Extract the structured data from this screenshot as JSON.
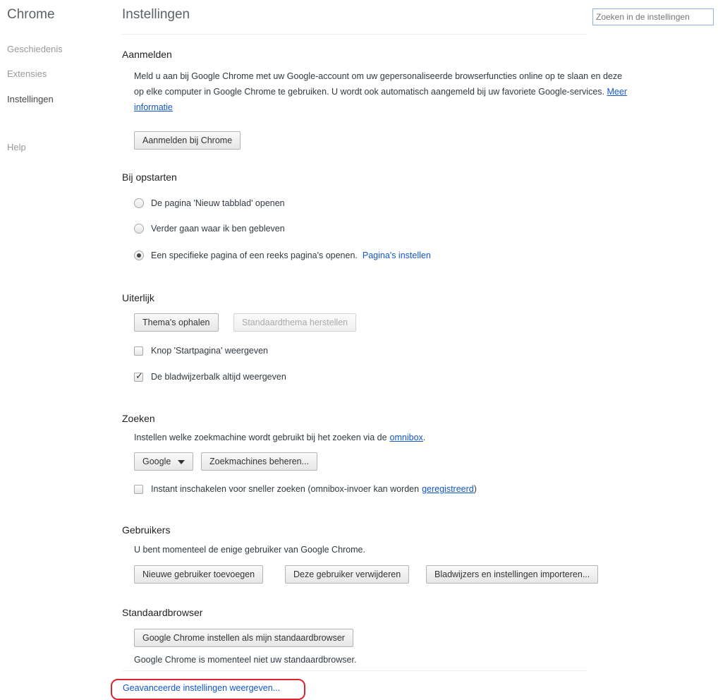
{
  "sidebar": {
    "brand": "Chrome",
    "items": [
      {
        "label": "Geschiedenis"
      },
      {
        "label": "Extensies"
      },
      {
        "label": "Instellingen"
      },
      {
        "label": "Help"
      }
    ]
  },
  "header": {
    "title": "Instellingen",
    "search_placeholder": "Zoeken in de instellingen"
  },
  "signin": {
    "heading": "Aanmelden",
    "text": "Meld u aan bij Google Chrome met uw Google-account om uw gepersonaliseerde browserfuncties online op te slaan en deze op elke computer in Google Chrome te gebruiken. U wordt ook automatisch aangemeld bij uw favoriete Google-services.",
    "more_link": "Meer informatie",
    "button": "Aanmelden bij Chrome"
  },
  "startup": {
    "heading": "Bij opstarten",
    "options": [
      {
        "label": "De pagina 'Nieuw tabblad' openen",
        "selected": false
      },
      {
        "label": "Verder gaan waar ik ben gebleven",
        "selected": false
      },
      {
        "label": "Een specifieke pagina of een reeks pagina's openen.",
        "selected": true
      }
    ],
    "set_pages_link": "Pagina's instellen"
  },
  "appearance": {
    "heading": "Uiterlijk",
    "get_themes": "Thema's ophalen",
    "reset_theme": "Standaardthema herstellen",
    "show_home": {
      "label": "Knop 'Startpagina' weergeven",
      "checked": false
    },
    "show_bookmarks": {
      "label": "De bladwijzerbalk altijd weergeven",
      "checked": true
    }
  },
  "search": {
    "heading": "Zoeken",
    "text": "Instellen welke zoekmachine wordt gebruikt bij het zoeken via de",
    "omnibox_link": "omnibox",
    "engine": "Google",
    "manage": "Zoekmachines beheren...",
    "instant_label": "Instant inschakelen voor sneller zoeken (omnibox-invoer kan worden",
    "instant_link": "geregistreerd",
    "instant_checked": false
  },
  "users": {
    "heading": "Gebruikers",
    "text": "U bent momenteel de enige gebruiker van Google Chrome.",
    "add": "Nieuwe gebruiker toevoegen",
    "remove": "Deze gebruiker verwijderen",
    "import": "Bladwijzers en instellingen importeren..."
  },
  "default_browser": {
    "heading": "Standaardbrowser",
    "button": "Google Chrome instellen als mijn standaardbrowser",
    "text": "Google Chrome is momenteel niet uw standaardbrowser."
  },
  "advanced_link": "Geavanceerde instellingen weergeven..."
}
